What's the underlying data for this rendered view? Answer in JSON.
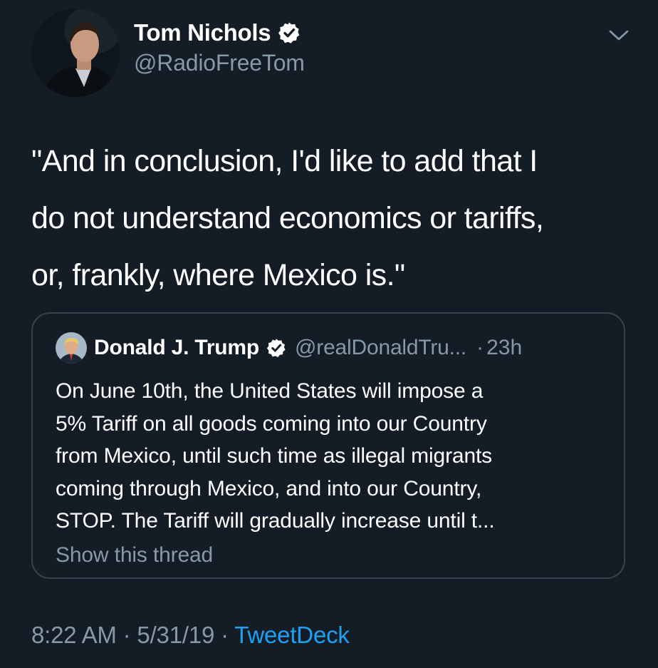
{
  "tweet": {
    "author": {
      "name": "Tom Nichols",
      "handle": "@RadioFreeTom",
      "verified": true,
      "avatar_icon": "profile-photo"
    },
    "text_lines": [
      "\"And in conclusion, I'd like to add that I",
      "do not understand economics or tariffs,",
      "or, frankly, where Mexico is.\""
    ],
    "menu_icon": "chevron-down-icon",
    "time": "8:22 AM",
    "separator": "·",
    "date": "5/31/19",
    "source": "TweetDeck"
  },
  "quoted_tweet": {
    "author": {
      "name": "Donald J. Trump",
      "handle": "@realDonaldTru...",
      "verified": true,
      "avatar_icon": "profile-photo"
    },
    "separator": "·",
    "time": "23h",
    "text_lines": [
      "On June 10th, the United States will impose a",
      "5% Tariff on all goods coming into our Country",
      "from Mexico, until such time as illegal migrants",
      "coming through Mexico, and into our Country,",
      "STOP. The Tariff will gradually increase until t..."
    ],
    "show_thread": "Show this thread"
  },
  "colors": {
    "background": "#141d26",
    "text_primary": "#ffffff",
    "text_secondary": "#8899a6",
    "link": "#1da1f2",
    "border": "#38444d"
  }
}
